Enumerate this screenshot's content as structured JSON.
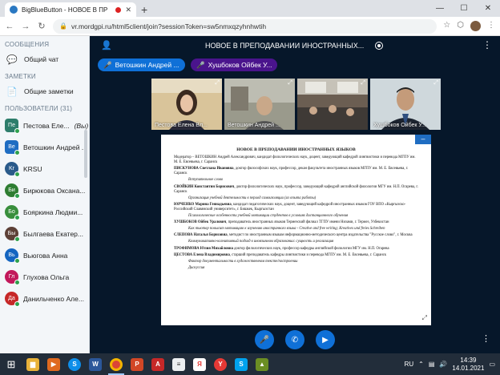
{
  "browser": {
    "tab_title": "BigBlueButton - НОВОЕ В ПР",
    "url": "vr.mordgpi.ru/html5client/join?sessionToken=sw5nmxqzyhnhwtih"
  },
  "sidebar": {
    "messages_header": "СООБЩЕНИЯ",
    "public_chat": "Общий чат",
    "notes_header": "ЗАМЕТКИ",
    "shared_notes": "Общие заметки",
    "users_header": "ПОЛЬЗОВАТЕЛИ (31)",
    "users": [
      {
        "initials": "Пе",
        "name": "Пестова Еле...",
        "suffix": "(Вы)",
        "color": "#2e7d6b",
        "shape": "square"
      },
      {
        "initials": "Ве",
        "name": "Ветошкин Андрей ...",
        "suffix": "",
        "color": "#1f6dc2",
        "shape": "square"
      },
      {
        "initials": "Kr",
        "name": "KRSU",
        "suffix": "",
        "color": "#2a5a8a",
        "shape": "round"
      },
      {
        "initials": "Би",
        "name": "Бирюкова Оксана...",
        "suffix": "",
        "color": "#2e7d32",
        "shape": "round"
      },
      {
        "initials": "Бо",
        "name": "Бояркина Людми...",
        "suffix": "",
        "color": "#388e3c",
        "shape": "round"
      },
      {
        "initials": "Бы",
        "name": "Былгаева Екатер...",
        "suffix": "",
        "color": "#5d4037",
        "shape": "round"
      },
      {
        "initials": "Вь",
        "name": "Вьюгова Анна",
        "suffix": "",
        "color": "#1565c0",
        "shape": "round"
      },
      {
        "initials": "Гл",
        "name": "Глухова Ольга",
        "suffix": "",
        "color": "#c2185b",
        "shape": "round"
      },
      {
        "initials": "Да",
        "name": "Данильченко Але...",
        "suffix": "",
        "color": "#c62828",
        "shape": "round"
      }
    ]
  },
  "main": {
    "meeting_title": "НОВОЕ В ПРЕПОДАВАНИИ ИНОСТРАННЫХ...",
    "talkers": [
      "Ветошкин Андрей ...",
      "Хушбоков Ойбек У..."
    ],
    "cameras": [
      {
        "label": "Пестова Елена Вл..."
      },
      {
        "label": "Ветошкин Андрей ..."
      },
      {
        "label": ""
      },
      {
        "label": "Хушбоков Ойбек У..."
      }
    ]
  },
  "slide": {
    "title": "НОВОЕ В ПРЕПОДАВАНИИ ИНОСТРАННЫХ ЯЗЫКОВ",
    "paragraphs": [
      {
        "bold": "",
        "text": "Модератор – ВЕТОШКИН Андрей Александрович, кандидат филологических наук, доцент, заведующий кафедрой лингвистики и перевода МГПУ им. М. Е. Евсевьева, г. Саранск",
        "italic": false
      },
      {
        "bold": "ПИСКУНОВА Светлана Ивановна",
        "text": ", доктор философских наук, профессор, декан факультета иностранных языков МГПУ им. М. Е. Евсевьева, г. Саранск",
        "italic": false
      },
      {
        "bold": "",
        "text": "Вступительное слово",
        "italic": true
      },
      {
        "bold": "СВОЙКИН Константин Борисович",
        "text": ", доктор филологических наук, профессор, заведующий кафедрой английской филологии МГУ им. Н.П. Огарева, г. Саранск",
        "italic": false
      },
      {
        "bold": "",
        "text": "Организация учебной деятельности в период самоизоляции (из опыта работы)",
        "italic": true
      },
      {
        "bold": "ЮРЧЕНКО Марина Геннадьевна",
        "text": ", кандидат педагогических наук, доцент, заведующий кафедрой иностранных языков ГОУ ВПО «Кыргызско-Российский Славянский университет», г. Бишкек, Кыргызстан",
        "italic": false
      },
      {
        "bold": "",
        "text": "Психологические особенности учебной мотивации студентов в условиях дистанционного обучения",
        "italic": true
      },
      {
        "bold": "ХУШБОКОВ Ойбек Уралович",
        "text": ", преподаватель иностранных языков Термезский филиал ТГПУ имени Низами, г. Термез, Узбекистан",
        "italic": false
      },
      {
        "bold": "",
        "text": "Как тьютор повысит мотивацию к изучению иностранного языка - Creative and free writing; Kreatives und freies Schreiben",
        "italic": true
      },
      {
        "bold": "СЛЕПОВА Наталья Борисовна",
        "text": ", методист по иностранным языкам информационно-методического центра издательства \"Русское слово\", г. Москва",
        "italic": false
      },
      {
        "bold": "",
        "text": "Коммуникативно-когнитивный подход в иноязычном образовании: сущность и реализация",
        "italic": true
      },
      {
        "bold": "ТРОФИМОВА Юлия Михайловна",
        "text": " доктор филологических наук, профессор кафедры английской филологии МГУ им. Н.П. Огарева",
        "italic": false
      },
      {
        "bold": "ЦЕСТОВА Елена Владимировна",
        "text": ", старший преподаватель кафедры лингвистики и перевода МГПУ им. М. Е. Евсевьева, г. Саранск",
        "italic": false
      },
      {
        "bold": "",
        "text": "Фактор документальности в художественном тексте/построении",
        "italic": true
      },
      {
        "bold": "",
        "text": "Дискуссия",
        "italic": true
      }
    ]
  },
  "taskbar": {
    "lang": "RU",
    "time": "14:39",
    "date": "14.01.2021"
  }
}
